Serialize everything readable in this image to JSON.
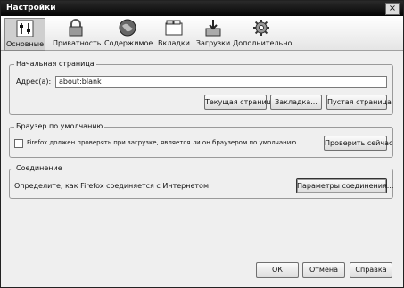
{
  "window": {
    "title": "Настройки",
    "close_symbol": "×"
  },
  "tabs": [
    {
      "label": "Основные",
      "icon": "general-switches-icon",
      "selected": true
    },
    {
      "label": "Приватность",
      "icon": "lock-icon"
    },
    {
      "label": "Содержимое",
      "icon": "globe-icon"
    },
    {
      "label": "Вкладки",
      "icon": "tabs-icon"
    },
    {
      "label": "Загрузки",
      "icon": "download-icon"
    },
    {
      "label": "Дополнительно",
      "icon": "gear-icon"
    }
  ],
  "home": {
    "legend": "Начальная страница",
    "address_label": "Адрес(а):",
    "address_value": "about:blank",
    "current_page_button": "Текущая страница",
    "bookmark_button": "Закладка...",
    "blank_page_button": "Пустая страница"
  },
  "default_browser": {
    "legend": "Браузер по умолчанию",
    "check_label": "Firefox должен проверять при загрузке, является ли он браузером по умолчанию",
    "checked": false,
    "check_now_button": "Проверить сейчас"
  },
  "connection": {
    "legend": "Соединение",
    "description": "Определите, как Firefox соединяется с Интернетом",
    "settings_button": "Параметры соединения..."
  },
  "footer": {
    "ok": "ОК",
    "cancel": "Отмена",
    "help": "Справка"
  }
}
